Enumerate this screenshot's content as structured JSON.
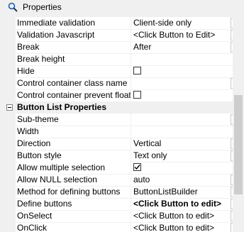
{
  "window": {
    "title": "Properties"
  },
  "rows_top": [
    {
      "name": "Immediate validation",
      "value": "Client-side only",
      "control": "dropdown"
    },
    {
      "name": "Validation Javascript",
      "value": "<Click Button to Edit>",
      "control": "ellipsis"
    },
    {
      "name": "Break",
      "value": "After",
      "control": "dropdown"
    },
    {
      "name": "Break height",
      "value": "",
      "control": "none"
    },
    {
      "name": "Hide",
      "value": "",
      "control": "checkbox",
      "checked": false
    },
    {
      "name": "Control container class name",
      "value": "",
      "control": "ellipsis"
    },
    {
      "name": "Control container prevent float",
      "value": "",
      "control": "checkbox",
      "checked": false
    }
  ],
  "section": {
    "label": "Button List Properties",
    "expanded": true
  },
  "rows_section": [
    {
      "name": "Sub-theme",
      "value": "",
      "control": "ellipsis"
    },
    {
      "name": "Width",
      "value": "",
      "control": "none"
    },
    {
      "name": "Direction",
      "value": "Vertical",
      "control": "dropdown"
    },
    {
      "name": "Button style",
      "value": "Text only",
      "control": "dropdown"
    },
    {
      "name": "Allow multiple selection",
      "value": "",
      "control": "checkbox",
      "checked": true
    },
    {
      "name": "Allow NULL selection",
      "value": "auto",
      "control": "dropdown"
    },
    {
      "name": "Method for defining buttons",
      "value": "ButtonListBuilder",
      "control": "dropdown"
    },
    {
      "name": "Define buttons",
      "value": "<Click Button to edit>",
      "control": "ellipsis",
      "bold": true
    },
    {
      "name": "OnSelect",
      "value": "<Click Button to edit>",
      "control": "ellipsis"
    },
    {
      "name": "OnClick",
      "value": "<Click Button to edit>",
      "control": "ellipsis"
    }
  ],
  "icons": {
    "window": "magnifier-icon",
    "dropdown": "chevron-down-icon",
    "ellipsis": "ellipsis-icon",
    "checkmark": "checkmark-icon",
    "collapse": "minus-box-icon"
  },
  "colors": {
    "background": "#f0f0f0",
    "grid": "#ffffff",
    "button_border": "#c8c8c8"
  }
}
